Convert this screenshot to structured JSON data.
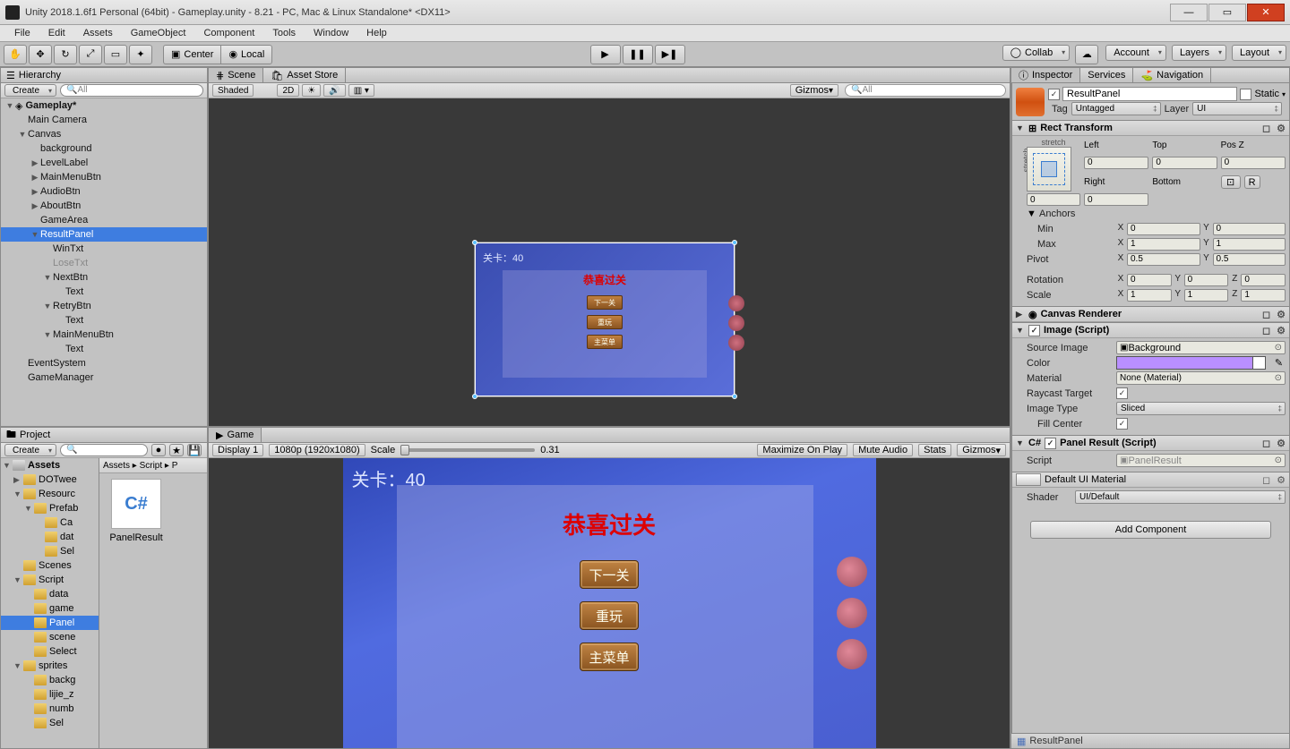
{
  "window": {
    "title": "Unity 2018.1.6f1 Personal (64bit) - Gameplay.unity - 8.21 - PC, Mac & Linux Standalone* <DX11>",
    "min": "—",
    "max": "▭",
    "close": "✕"
  },
  "menu": [
    "File",
    "Edit",
    "Assets",
    "GameObject",
    "Component",
    "Tools",
    "Window",
    "Help"
  ],
  "toolbar": {
    "pivot_center": "Center",
    "pivot_local": "Local",
    "collab": "Collab",
    "account": "Account",
    "layers": "Layers",
    "layout": "Layout"
  },
  "hierarchy": {
    "tab": "Hierarchy",
    "create": "Create",
    "search_ph": "All",
    "root": "Gameplay*",
    "items": [
      {
        "d": 1,
        "label": "Main Camera"
      },
      {
        "d": 1,
        "label": "Canvas",
        "fold": "▼"
      },
      {
        "d": 2,
        "label": "background"
      },
      {
        "d": 2,
        "label": "LevelLabel",
        "fold": "▶"
      },
      {
        "d": 2,
        "label": "MainMenuBtn",
        "fold": "▶"
      },
      {
        "d": 2,
        "label": "AudioBtn",
        "fold": "▶"
      },
      {
        "d": 2,
        "label": "AboutBtn",
        "fold": "▶"
      },
      {
        "d": 2,
        "label": "GameArea"
      },
      {
        "d": 2,
        "label": "ResultPanel",
        "fold": "▼",
        "sel": true
      },
      {
        "d": 3,
        "label": "WinTxt"
      },
      {
        "d": 3,
        "label": "LoseTxt",
        "dim": true
      },
      {
        "d": 3,
        "label": "NextBtn",
        "fold": "▼"
      },
      {
        "d": 4,
        "label": "Text"
      },
      {
        "d": 3,
        "label": "RetryBtn",
        "fold": "▼"
      },
      {
        "d": 4,
        "label": "Text"
      },
      {
        "d": 3,
        "label": "MainMenuBtn",
        "fold": "▼"
      },
      {
        "d": 4,
        "label": "Text"
      },
      {
        "d": 1,
        "label": "EventSystem"
      },
      {
        "d": 1,
        "label": "GameManager"
      }
    ]
  },
  "scene": {
    "tab1": "Scene",
    "tab2": "Asset Store",
    "shaded": "Shaded",
    "twod": "2D",
    "gizmos": "Gizmos",
    "search_ph": "All",
    "level": "关卡：40",
    "title": "恭喜过关",
    "btn1": "下一关",
    "btn2": "重玩",
    "btn3": "主菜单"
  },
  "game": {
    "tab": "Game",
    "display": "Display 1",
    "res": "1080p (1920x1080)",
    "scale_lbl": "Scale",
    "scale_val": "0.31",
    "max": "Maximize On Play",
    "mute": "Mute Audio",
    "stats": "Stats",
    "gizmos": "Gizmos",
    "level": "关卡：40",
    "title": "恭喜过关",
    "btn1": "下一关",
    "btn2": "重玩",
    "btn3": "主菜单"
  },
  "project": {
    "tab": "Project",
    "create": "Create",
    "breadcrumb": "Assets ▸ Script ▸ P",
    "asset_name": "PanelResult",
    "asset_thumb": "C#",
    "tree": [
      {
        "d": 0,
        "label": "Assets",
        "top": true,
        "fold": "▼",
        "bold": true
      },
      {
        "d": 1,
        "label": "DOTwee",
        "fold": "▶"
      },
      {
        "d": 1,
        "label": "Resourc",
        "fold": "▼"
      },
      {
        "d": 2,
        "label": "Prefab",
        "fold": "▼"
      },
      {
        "d": 3,
        "label": "Ca"
      },
      {
        "d": 3,
        "label": "dat"
      },
      {
        "d": 3,
        "label": "Sel"
      },
      {
        "d": 1,
        "label": "Scenes"
      },
      {
        "d": 1,
        "label": "Script",
        "fold": "▼"
      },
      {
        "d": 2,
        "label": "data"
      },
      {
        "d": 2,
        "label": "game"
      },
      {
        "d": 2,
        "label": "Panel",
        "sel": true
      },
      {
        "d": 2,
        "label": "scene"
      },
      {
        "d": 2,
        "label": "Select"
      },
      {
        "d": 1,
        "label": "sprites",
        "fold": "▼"
      },
      {
        "d": 2,
        "label": "backg"
      },
      {
        "d": 2,
        "label": "lijie_z"
      },
      {
        "d": 2,
        "label": "numb"
      },
      {
        "d": 2,
        "label": "Sel"
      }
    ]
  },
  "inspector": {
    "tab1": "Inspector",
    "tab2": "Services",
    "tab3": "Navigation",
    "go_name": "ResultPanel",
    "static": "Static",
    "tag_lbl": "Tag",
    "tag_val": "Untagged",
    "layer_lbl": "Layer",
    "layer_val": "UI",
    "rect": {
      "title": "Rect Transform",
      "stretch": "stretch",
      "left_lbl": "Left",
      "left": "0",
      "top_lbl": "Top",
      "top": "0",
      "posz_lbl": "Pos Z",
      "posz": "0",
      "right_lbl": "Right",
      "right": "0",
      "bottom_lbl": "Bottom",
      "bottom": "0",
      "anchors": "Anchors",
      "min_lbl": "Min",
      "min_x": "0",
      "min_y": "0",
      "max_lbl": "Max",
      "max_x": "1",
      "max_y": "1",
      "pivot_lbl": "Pivot",
      "piv_x": "0.5",
      "piv_y": "0.5",
      "rot_lbl": "Rotation",
      "rot_x": "0",
      "rot_y": "0",
      "rot_z": "0",
      "scale_lbl": "Scale",
      "s_x": "1",
      "s_y": "1",
      "s_z": "1"
    },
    "canvas_renderer": "Canvas Renderer",
    "image": {
      "title": "Image (Script)",
      "src_lbl": "Source Image",
      "src": "Background",
      "color_lbl": "Color",
      "color": "#b98fff",
      "mat_lbl": "Material",
      "mat": "None (Material)",
      "ray_lbl": "Raycast Target",
      "type_lbl": "Image Type",
      "type": "Sliced",
      "fill_lbl": "Fill Center"
    },
    "panelresult": {
      "title": "Panel Result (Script)",
      "script_lbl": "Script",
      "script": "PanelResult"
    },
    "defmat": {
      "title": "Default UI Material",
      "shader_lbl": "Shader",
      "shader": "UI/Default"
    },
    "add": "Add Component",
    "status": "ResultPanel"
  }
}
